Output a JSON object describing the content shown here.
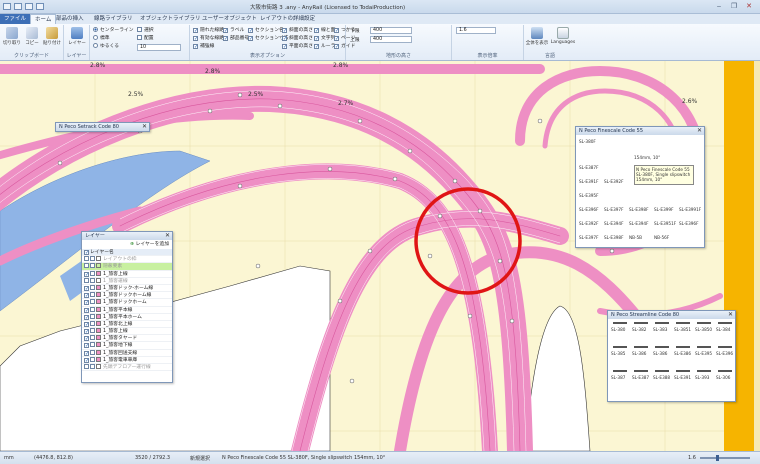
{
  "window": {
    "title": "大阪市街路 3 .any - AnyRail (Licensed to TodaiProduction)",
    "controls": [
      "‒",
      "❐",
      "✕"
    ]
  },
  "tabs": [
    {
      "label": "ファイル",
      "kind": "file"
    },
    {
      "label": "ホーム",
      "kind": "active"
    },
    {
      "label": "部品の挿入",
      "kind": "normal"
    },
    {
      "label": "線路ライブラリ",
      "kind": "normal"
    },
    {
      "label": "オブジェクトライブラリ",
      "kind": "normal"
    },
    {
      "label": "ユーザーオブジェクト",
      "kind": "normal"
    },
    {
      "label": "レイアウトの詳細設定",
      "kind": "normal"
    }
  ],
  "ribbon": {
    "clipboard": {
      "cut": "切り取り",
      "copy": "コピー",
      "paste": "貼り付け",
      "label": "クリップボード"
    },
    "layer": {
      "button": "レイヤー",
      "label": "レイヤー"
    },
    "snap": {
      "center": "センターライン",
      "standard": "標準",
      "loose": "ゆるくる",
      "select": "選択",
      "place": "配置",
      "input_value": "10"
    },
    "display": {
      "label": "表示オプション",
      "col1": [
        "隠れた線路",
        "有効な線路",
        "補強線"
      ],
      "col2": [
        "ラベル",
        "部品番号"
      ],
      "col3": [
        "セクション名",
        "セクション寸法"
      ],
      "col4": [
        "斜面の高さ",
        "斜面の高さ",
        "平面の高さ"
      ],
      "col5": [
        "線と面",
        "文字列",
        "ルーラ"
      ],
      "col6": [
        "つかる",
        "ページ",
        "ガイド"
      ]
    },
    "coords": {
      "label": "地形の高さ",
      "x_label": "下限",
      "x_value": "400",
      "y_label": "上限",
      "y_value": "400"
    },
    "scale": {
      "value": "1.6",
      "label": "表示倍率"
    },
    "view_all": "全体を表示",
    "languages": "Languages",
    "lang_label": "言語"
  },
  "canvas": {
    "grade_labels": [
      "2.8%",
      "2.8%",
      "2.8%",
      "2.5%",
      "2.5%",
      "2.7%",
      "2.6%"
    ],
    "colors": {
      "track": "#ee8fc4",
      "track_dark": "#d9579e",
      "water": "#8fb4e6",
      "ground": "#fbf6d3",
      "white_area": "#ffffff",
      "accent_bar": "#f6b400",
      "circle": "#e01515"
    }
  },
  "panels": {
    "setrack": {
      "title": "N Peco Setrack Code 80"
    },
    "layers": {
      "title": "レイヤー",
      "add_button": "レイヤーを追加",
      "header": "レイヤー名",
      "rows": [
        {
          "name": "レイアウトの枠",
          "checked": false,
          "color": "#ffffff"
        },
        {
          "name": "隠蔽要素",
          "checked": false,
          "color": "#c8f0a0",
          "highlight": true
        },
        {
          "name": "1_旅客上線",
          "checked": true,
          "color": "#ee8fc4"
        },
        {
          "name": "1_旅客運線",
          "checked": false,
          "color": "#ffffff"
        },
        {
          "name": "1_旅客ドック-ホーム線",
          "checked": true,
          "color": "#ee8fc4"
        },
        {
          "name": "1_旅客ドックホーム線",
          "checked": true,
          "color": "#ee8fc4"
        },
        {
          "name": "1_旅客ドックホーム",
          "checked": true,
          "color": "#ee8fc4"
        },
        {
          "name": "1_旅客平本線",
          "checked": true,
          "color": "#ee8fc4"
        },
        {
          "name": "1_旅客平本ホーム",
          "checked": true,
          "color": "#ee8fc4"
        },
        {
          "name": "1_旅客北上線",
          "checked": true,
          "color": "#ee8fc4"
        },
        {
          "name": "1_旅客上線",
          "checked": true,
          "color": "#ee8fc4"
        },
        {
          "name": "1_旅客タヤード",
          "checked": true,
          "color": "#ee8fc4"
        },
        {
          "name": "1_旅客地下線",
          "checked": true,
          "color": "#ee8fc4"
        },
        {
          "name": "1_旅客回送支線",
          "checked": true,
          "color": "#ee8fc4"
        },
        {
          "name": "1_旅客電車車庫",
          "checked": true,
          "color": "#ee8fc4"
        },
        {
          "name": "先頭デフロアー運行線",
          "checked": false,
          "color": "#ffffff"
        }
      ]
    },
    "finescale": {
      "title": "N Peco Finescale Code 55",
      "tooltip": [
        "N Peco Finescale Code 55",
        "SL-380F, Single slipswitch",
        "154mm, 10°"
      ],
      "parts": [
        "SL-380F",
        "SL-E387F",
        "SL-E391F",
        "SL-E392F",
        "SL-E395F",
        "SL-E396F",
        "SL-E397F",
        "SL-E398F",
        "SL-E399F",
        "SL-E3991F",
        "SL-E392F",
        "SL-E394F",
        "SL-E394F",
        "SL-E3951F",
        "SL-E396F",
        "SL-E397F",
        "SL-E398F",
        "NB-5B",
        "NB-56F"
      ],
      "subtitle": "154mm, 10°"
    },
    "streamline": {
      "title": "N Peco Streamline Code 80",
      "parts": [
        "SL-380",
        "SL-382",
        "SL-383",
        "SL-3851",
        "SL-3850",
        "SL-384",
        "SL-385",
        "SL-386",
        "SL-386",
        "SL-E386",
        "SL-E395",
        "SL-E396",
        "SL-387",
        "SL-E387",
        "SL-E388",
        "SL-E391",
        "SL-393",
        "SL-306"
      ]
    }
  },
  "statusbar": {
    "units": "mm",
    "coords": "(4476.8, 812.8)",
    "size": "3520 / 2792.3",
    "mode": "新規選択",
    "hint": "N Peco Finescale Code 55 SL-380F, Single slipswitch 154mm, 10°",
    "zoom": "1.6"
  }
}
